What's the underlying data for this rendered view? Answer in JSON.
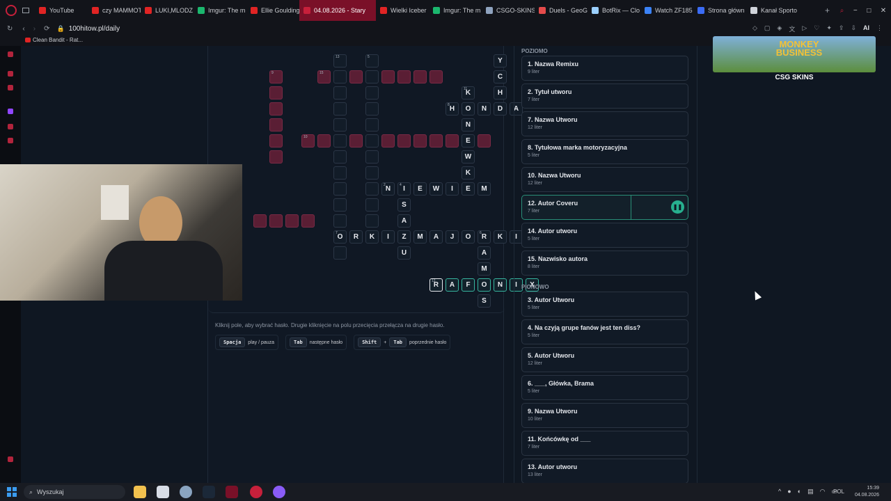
{
  "browser": {
    "tabs": [
      {
        "label": "YouTube",
        "color": "#e02424"
      },
      {
        "label": "czy MAMMOT",
        "color": "#e02424"
      },
      {
        "label": "LUKI,MLODZ",
        "color": "#e02424"
      },
      {
        "label": "Imgur: The m",
        "color": "#1bb76e"
      },
      {
        "label": "Ellie Goulding",
        "color": "#e02424"
      },
      {
        "label": "04.08.2026 - Stary",
        "color": "#c7203b",
        "active": true
      },
      {
        "label": "Wielki Iceber",
        "color": "#e02424"
      },
      {
        "label": "Imgur: The m",
        "color": "#1bb76e"
      },
      {
        "label": "CSGO-SKINS",
        "color": "#8fa3bf"
      },
      {
        "label": "Duels - GeoG",
        "color": "#e54b4b"
      },
      {
        "label": "BotRix — Clo",
        "color": "#9bd0ff"
      },
      {
        "label": "Watch ZF185",
        "color": "#3b82f6"
      },
      {
        "label": "Strona główn",
        "color": "#3b6cf6"
      },
      {
        "label": "Kanał Sporto",
        "color": "#cfd3da"
      }
    ],
    "url": "100hitow.pl/daily",
    "bookmark": "Clean Bandit - Rat...",
    "ai_label": "AI"
  },
  "crossword": {
    "hint_text": "Kliknij pole, aby wybrać hasło. Drugie kliknięcie na polu przecięcia przełącza na drugie hasło.",
    "shortcuts": [
      {
        "keys": [
          "Spacja"
        ],
        "label": "play / pauza"
      },
      {
        "keys": [
          "Tab"
        ],
        "label": "następne hasło"
      },
      {
        "keys": [
          "Shift",
          "Tab"
        ],
        "label": "poprzednie hasło"
      }
    ],
    "shortcut_plus": "+",
    "cells": [
      {
        "c": 3,
        "r": 0,
        "n": "13"
      },
      {
        "c": 5,
        "r": 0,
        "n": "5"
      },
      {
        "c": 13,
        "r": 0,
        "ch": "Y"
      },
      {
        "c": -1,
        "r": 1,
        "n": "9",
        "red": true
      },
      {
        "c": 2,
        "r": 1,
        "n": "15",
        "red": true
      },
      {
        "c": 3,
        "r": 1
      },
      {
        "c": 4,
        "r": 1,
        "red": true
      },
      {
        "c": 5,
        "r": 1
      },
      {
        "c": 6,
        "r": 1,
        "red": true
      },
      {
        "c": 7,
        "r": 1,
        "red": true
      },
      {
        "c": 8,
        "r": 1,
        "red": true
      },
      {
        "c": 9,
        "r": 1,
        "red": true
      },
      {
        "c": 13,
        "r": 1,
        "ch": "C"
      },
      {
        "c": -1,
        "r": 2,
        "red": true
      },
      {
        "c": 3,
        "r": 2
      },
      {
        "c": 5,
        "r": 2
      },
      {
        "c": 11,
        "r": 2,
        "ch": "K",
        "n": "11"
      },
      {
        "c": 13,
        "r": 2,
        "ch": "H"
      },
      {
        "c": -1,
        "r": 3,
        "red": true
      },
      {
        "c": 3,
        "r": 3
      },
      {
        "c": 5,
        "r": 3
      },
      {
        "c": 10,
        "r": 3,
        "ch": "H",
        "n": "8"
      },
      {
        "c": 11,
        "r": 3,
        "ch": "O"
      },
      {
        "c": 12,
        "r": 3,
        "ch": "N"
      },
      {
        "c": 13,
        "r": 3,
        "ch": "D"
      },
      {
        "c": 14,
        "r": 3,
        "ch": "A"
      },
      {
        "c": -1,
        "r": 4,
        "red": true
      },
      {
        "c": 3,
        "r": 4
      },
      {
        "c": 5,
        "r": 4
      },
      {
        "c": 11,
        "r": 4,
        "ch": "N"
      },
      {
        "c": -1,
        "r": 5,
        "red": true
      },
      {
        "c": 1,
        "r": 5,
        "n": "10",
        "red": true
      },
      {
        "c": 2,
        "r": 5,
        "red": true
      },
      {
        "c": 3,
        "r": 5
      },
      {
        "c": 4,
        "r": 5,
        "red": true
      },
      {
        "c": 5,
        "r": 5
      },
      {
        "c": 6,
        "r": 5,
        "red": true
      },
      {
        "c": 7,
        "r": 5,
        "red": true
      },
      {
        "c": 8,
        "r": 5,
        "red": true
      },
      {
        "c": 9,
        "r": 5,
        "red": true
      },
      {
        "c": 10,
        "r": 5,
        "red": true
      },
      {
        "c": 11,
        "r": 5,
        "ch": "E"
      },
      {
        "c": 12,
        "r": 5,
        "red": true
      },
      {
        "c": -1,
        "r": 6,
        "red": true
      },
      {
        "c": 3,
        "r": 6
      },
      {
        "c": 5,
        "r": 6
      },
      {
        "c": 11,
        "r": 6,
        "ch": "W"
      },
      {
        "c": 3,
        "r": 7
      },
      {
        "c": 5,
        "r": 7
      },
      {
        "c": 11,
        "r": 7,
        "ch": "K"
      },
      {
        "c": 3,
        "r": 8
      },
      {
        "c": 5,
        "r": 8
      },
      {
        "c": 6,
        "r": 8,
        "ch": "N",
        "n": "2"
      },
      {
        "c": 7,
        "r": 8,
        "ch": "I",
        "n": "4"
      },
      {
        "c": 8,
        "r": 8,
        "ch": "E"
      },
      {
        "c": 9,
        "r": 8,
        "ch": "W"
      },
      {
        "c": 10,
        "r": 8,
        "ch": "I"
      },
      {
        "c": 11,
        "r": 8,
        "ch": "E"
      },
      {
        "c": 12,
        "r": 8,
        "ch": "M"
      },
      {
        "c": 3,
        "r": 9
      },
      {
        "c": 5,
        "r": 9
      },
      {
        "c": 7,
        "r": 9,
        "ch": "S"
      },
      {
        "c": -2,
        "r": 10,
        "red": true
      },
      {
        "c": -1,
        "r": 10,
        "red": true
      },
      {
        "c": 0,
        "r": 10,
        "red": true
      },
      {
        "c": 1,
        "r": 10,
        "red": true
      },
      {
        "c": 3,
        "r": 10
      },
      {
        "c": 5,
        "r": 10
      },
      {
        "c": 7,
        "r": 10,
        "ch": "A"
      },
      {
        "c": 3,
        "r": 11,
        "ch": "O",
        "n": "7"
      },
      {
        "c": 4,
        "r": 11,
        "ch": "R"
      },
      {
        "c": 5,
        "r": 11,
        "ch": "K"
      },
      {
        "c": 6,
        "r": 11,
        "ch": "I"
      },
      {
        "c": 7,
        "r": 11,
        "ch": "Z"
      },
      {
        "c": 8,
        "r": 11,
        "ch": "M"
      },
      {
        "c": 9,
        "r": 11,
        "ch": "A"
      },
      {
        "c": 10,
        "r": 11,
        "ch": "J"
      },
      {
        "c": 11,
        "r": 11,
        "ch": "O"
      },
      {
        "c": 12,
        "r": 11,
        "ch": "R",
        "n": "6"
      },
      {
        "c": 13,
        "r": 11,
        "ch": "K"
      },
      {
        "c": 14,
        "r": 11,
        "ch": "I"
      },
      {
        "c": 3,
        "r": 12
      },
      {
        "c": 7,
        "r": 12,
        "ch": "U"
      },
      {
        "c": 12,
        "r": 12,
        "ch": "A"
      },
      {
        "c": 12,
        "r": 13,
        "ch": "M"
      },
      {
        "c": 9,
        "r": 14,
        "ch": "R",
        "n": "12",
        "active": true,
        "cur": true
      },
      {
        "c": 10,
        "r": 14,
        "ch": "A",
        "active": true
      },
      {
        "c": 11,
        "r": 14,
        "ch": "F",
        "active": true
      },
      {
        "c": 12,
        "r": 14,
        "ch": "O",
        "active": true
      },
      {
        "c": 13,
        "r": 14,
        "ch": "N",
        "active": true
      },
      {
        "c": 14,
        "r": 14,
        "ch": "I",
        "active": true
      },
      {
        "c": 15,
        "r": 14,
        "ch": "X",
        "active": true
      },
      {
        "c": 12,
        "r": 15,
        "ch": "S"
      }
    ]
  },
  "clues": {
    "across_title": "POZIOMO",
    "across": [
      {
        "title": "1. Nazwa Remixu",
        "sub": "9 liter"
      },
      {
        "title": "2. Tytuł utworu",
        "sub": "7 liter"
      },
      {
        "title": "7. Nazwa Utworu",
        "sub": "12 liter"
      },
      {
        "title": "8. Tytułowa marka motoryzacyjna",
        "sub": "5 liter"
      },
      {
        "title": "10. Nazwa Utworu",
        "sub": "12 liter"
      },
      {
        "title": "12. Autor Coveru",
        "sub": "7 liter",
        "active": true
      },
      {
        "title": "14. Autor utworu",
        "sub": "5 liter"
      },
      {
        "title": "15. Nazwisko autora",
        "sub": "8 liter"
      }
    ],
    "down_title": "PIONOWO",
    "down": [
      {
        "title": "3. Autor Utworu",
        "sub": "5 liter"
      },
      {
        "title": "4. Na czyją grupe fanów jest ten diss?",
        "sub": "5 liter"
      },
      {
        "title": "5. Autor Utworu",
        "sub": "12 liter"
      },
      {
        "title": "6. ___, Główka, Brama",
        "sub": "5 liter"
      },
      {
        "title": "9. Nazwa Utworu",
        "sub": "10 liter"
      },
      {
        "title": "11. Końcówkę od ___",
        "sub": "7 liter"
      },
      {
        "title": "13. Autor utworu",
        "sub": "13 liter"
      }
    ]
  },
  "ad": {
    "title": "MONKEY BUSINESS",
    "brand": "CSG SKINS"
  },
  "taskbar": {
    "search": "Wyszukaj",
    "lang": "POL",
    "time": "15:39",
    "date": "04.08.2026"
  }
}
